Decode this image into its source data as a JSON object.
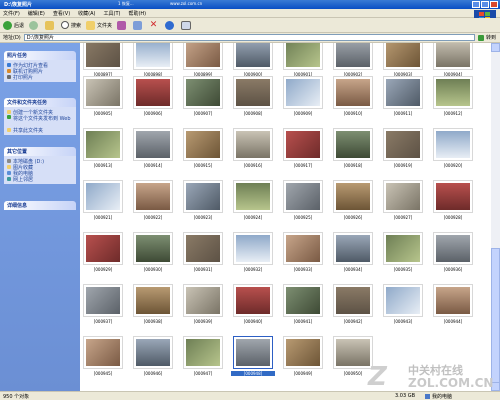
{
  "window": {
    "title": "D:\\恢复照片"
  },
  "taskbar_tabs": [
    {
      "label": "1 恢复...",
      "color": "#d9482b"
    },
    {
      "label": "www.zol.com.cn",
      "color": "#5b9e45"
    }
  ],
  "menu": [
    "文件(F)",
    "编辑(E)",
    "查看(V)",
    "收藏(A)",
    "工具(T)",
    "帮助(H)"
  ],
  "toolbar": {
    "back": "后退",
    "search": "搜索",
    "folders": "文件夹"
  },
  "address": {
    "label": "地址(D)",
    "value": "D:\\恢复照片",
    "go": "转到"
  },
  "sidebar": {
    "panels": [
      {
        "title": "照片任务",
        "items": [
          "作为幻灯片查看",
          "联机订购照片",
          "打印照片"
        ]
      },
      {
        "title": "文件和文件夹任务",
        "items": [
          "创建一个新文件夹",
          "将这个文件夹发布到 Web",
          "共享此文件夹"
        ]
      },
      {
        "title": "其它位置",
        "items": [
          "本地磁盘 (D:)",
          "图片收藏",
          "我的电脑",
          "网上邻居"
        ]
      },
      {
        "title": "详细信息",
        "items": []
      }
    ]
  },
  "thumbnails": [
    {
      "label": "[000897]"
    },
    {
      "label": "[000898]"
    },
    {
      "label": "[000899]"
    },
    {
      "label": "[000900]"
    },
    {
      "label": "[000901]"
    },
    {
      "label": "[000902]"
    },
    {
      "label": "[000903]"
    },
    {
      "label": "[000904]"
    },
    {
      "label": "[000905]"
    },
    {
      "label": "[000906]"
    },
    {
      "label": "[000907]"
    },
    {
      "label": "[000908]"
    },
    {
      "label": "[000909]"
    },
    {
      "label": "[000910]"
    },
    {
      "label": "[000911]"
    },
    {
      "label": "[000912]"
    },
    {
      "label": "[000913]"
    },
    {
      "label": "[000914]"
    },
    {
      "label": "[000915]"
    },
    {
      "label": "[000916]"
    },
    {
      "label": "[000917]"
    },
    {
      "label": "[000918]"
    },
    {
      "label": "[000919]"
    },
    {
      "label": "[000920]"
    },
    {
      "label": "[000921]"
    },
    {
      "label": "[000922]"
    },
    {
      "label": "[000923]"
    },
    {
      "label": "[000924]"
    },
    {
      "label": "[000925]"
    },
    {
      "label": "[000926]"
    },
    {
      "label": "[000927]"
    },
    {
      "label": "[000928]"
    },
    {
      "label": "[000929]"
    },
    {
      "label": "[000930]"
    },
    {
      "label": "[000931]"
    },
    {
      "label": "[000932]"
    },
    {
      "label": "[000933]"
    },
    {
      "label": "[000934]"
    },
    {
      "label": "[000935]"
    },
    {
      "label": "[000936]"
    },
    {
      "label": "[000937]"
    },
    {
      "label": "[000938]"
    },
    {
      "label": "[000939]"
    },
    {
      "label": "[000940]"
    },
    {
      "label": "[000941]"
    },
    {
      "label": "[000942]"
    },
    {
      "label": "[000943]"
    },
    {
      "label": "[000944]"
    },
    {
      "label": "[000945]"
    },
    {
      "label": "[000946]"
    },
    {
      "label": "[000947]"
    },
    {
      "label": "[000948]",
      "selected": true
    },
    {
      "label": "[000949]"
    },
    {
      "label": "[000950]"
    }
  ],
  "statusbar": {
    "left": "950 个对象",
    "size": "3.03 GB",
    "computer": "我的电脑"
  },
  "watermark": {
    "line1": "中关村在线",
    "line2": "ZOL.COM.CN"
  },
  "colors": {
    "titlebar": "#0a4fc4",
    "sidebar": "#6b8fd4",
    "selection": "#316ac5",
    "statusbar": "#ece9d8"
  },
  "icons": {
    "toolbar": [
      "back-icon",
      "forward-icon",
      "up-folder-icon",
      "search-icon",
      "folders-icon",
      "move-to-icon",
      "copy-to-icon",
      "delete-icon",
      "undo-icon",
      "views-icon"
    ]
  }
}
